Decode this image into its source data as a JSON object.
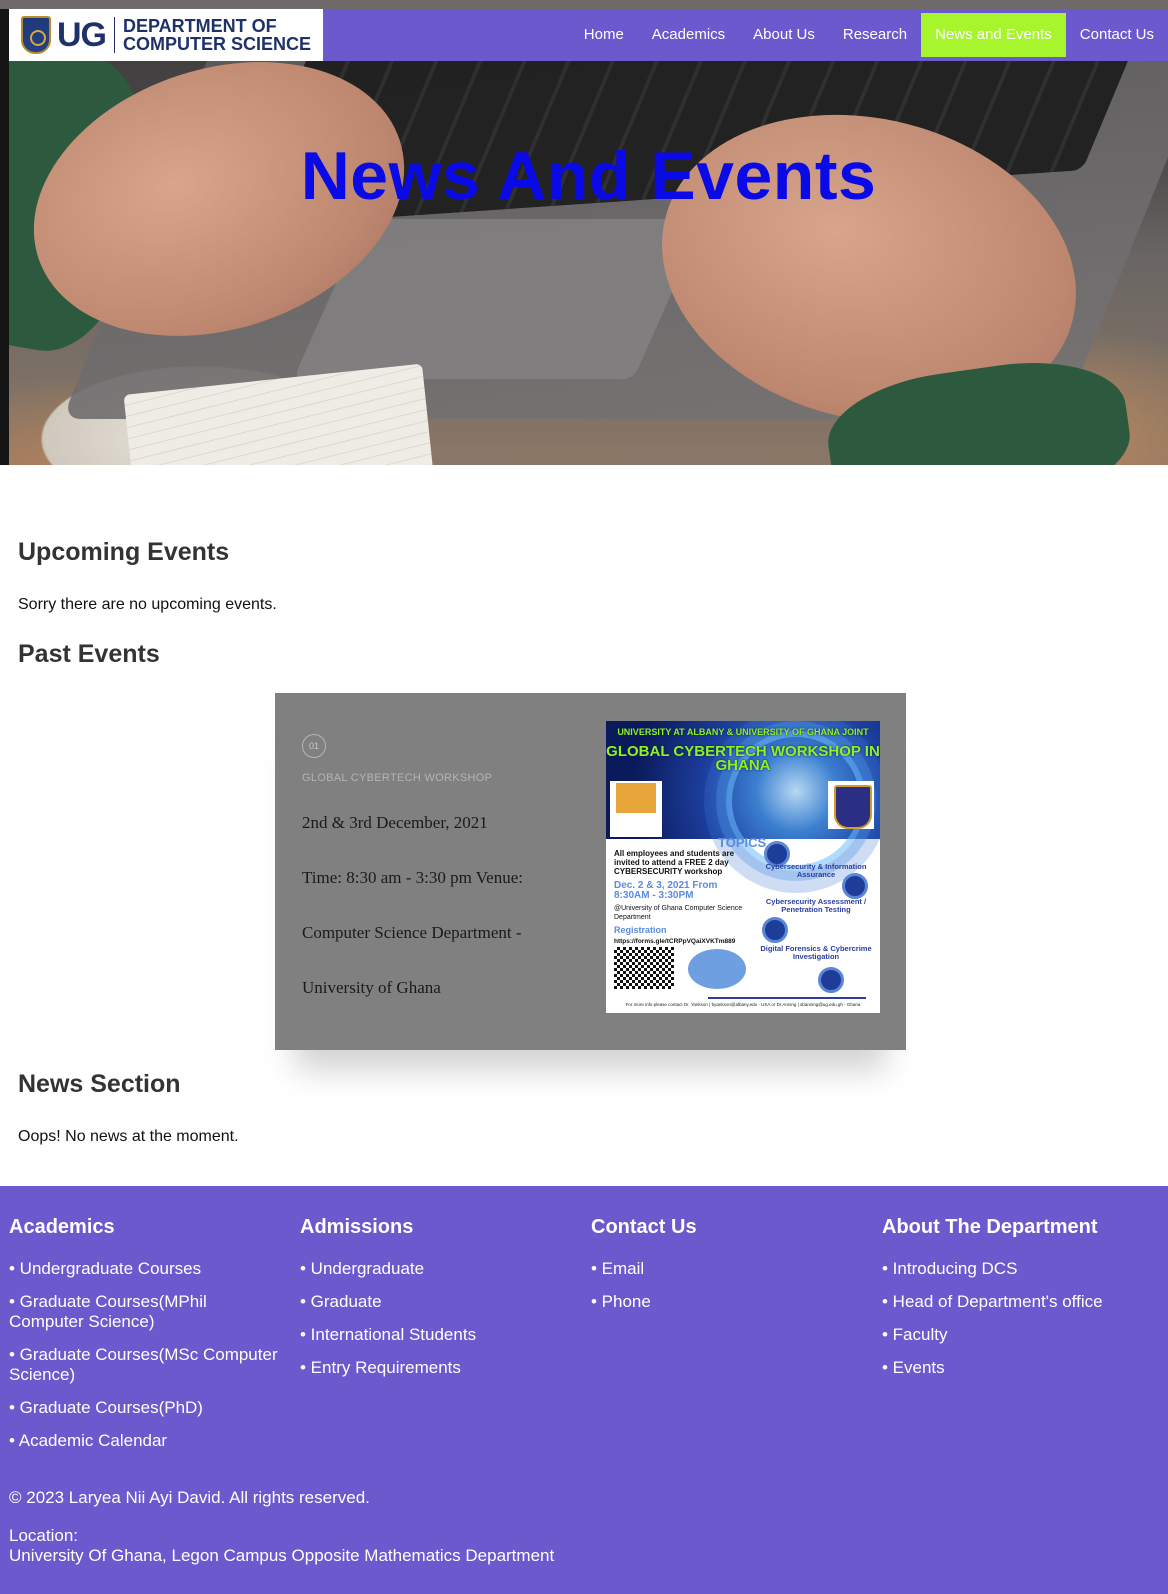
{
  "header": {
    "logo_ug": "UG",
    "logo_dept_line1": "DEPARTMENT OF",
    "logo_dept_line2": "COMPUTER SCIENCE",
    "nav": [
      "Home",
      "Academics",
      "About Us",
      "Research",
      "News and Events",
      "Contact Us"
    ],
    "active_nav": "News and Events",
    "accent_color": "#6c59ce",
    "active_color": "#a7f62d"
  },
  "hero": {
    "title": "News And Events",
    "title_color": "#0a0ae6"
  },
  "upcoming": {
    "heading": "Upcoming Events",
    "message": "Sorry there are no upcoming events."
  },
  "past": {
    "heading": "Past Events",
    "event": {
      "number": "01",
      "tag": "GLOBAL CYBERTECH WORKSHOP",
      "date": "2nd & 3rd December, 2021",
      "time": "Time: 8:30 am - 3:30 pm Venue:",
      "venue_line1": "Computer Science Department -",
      "venue_line2": "University of Ghana",
      "poster": {
        "header_small": "UNIVERSITY AT ALBANY & UNIVERSITY OF GHANA JOINT",
        "header_big": "GLOBAL CYBERTECH WORKSHOP IN GHANA",
        "topics": "TOPICS",
        "invite": "All employees and students are invited to attend a FREE 2 day CYBERSECURITY workshop",
        "date": "Dec. 2 & 3, 2021 From 8:30AM - 3:30PM",
        "location": "@University of Ghana Computer Science Department",
        "registration": "Registration",
        "url": "https://forms.gle/tCRPpVQaiXVKTm889",
        "topic1": "Cybersecurity & Information Assurance",
        "topic2": "Cybersecurity Assessment / Penetration Testing",
        "topic3": "Digital Forensics & Cybercrime Investigation",
        "footer": "For more info please contact Dr. Yankson | byankson@albany.edu - USA or Dr Anning | sbanning@ug.edu.gh - Ghana"
      }
    }
  },
  "news": {
    "heading": "News Section",
    "message": "Oops! No news at the moment."
  },
  "footer": {
    "columns": [
      {
        "title": "Academics",
        "items": [
          "• Undergraduate Courses",
          "• Graduate Courses(MPhil Computer Science)",
          "• Graduate Courses(MSc Computer Science)",
          "• Graduate Courses(PhD)",
          "• Academic Calendar"
        ]
      },
      {
        "title": "Admissions",
        "items": [
          "• Undergraduate",
          "• Graduate",
          "• International Students",
          "• Entry Requirements"
        ]
      },
      {
        "title": "Contact Us",
        "items": [
          "• Email",
          "• Phone"
        ]
      },
      {
        "title": "About The Department",
        "items": [
          "• Introducing DCS",
          "• Head of Department's office",
          "• Faculty",
          "• Events"
        ]
      }
    ],
    "copyright": "© 2023 Laryea Nii Ayi David. All rights reserved.",
    "location_label": "Location:",
    "location_value": "University Of Ghana, Legon Campus Opposite Mathematics Department"
  }
}
